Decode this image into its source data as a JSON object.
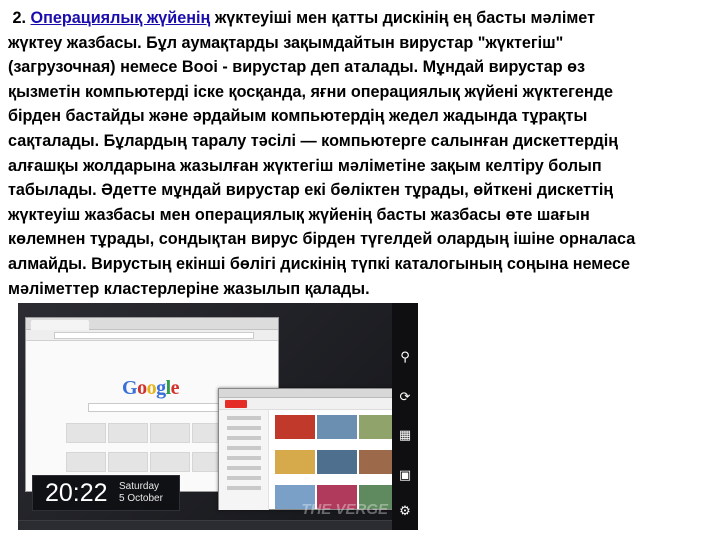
{
  "paragraph": {
    "number": "2.",
    "link_text": "Операциялық жүйенің",
    "line1_rest": "жүктеуіші мен қатты дискінің ең басты мәлімет",
    "line2": "жүктеу жазбасы. Бұл аумақтарды зақымдайтын вирустар \"жүктегіш\"",
    "line3": "(загрузочная) немесе Booi - вирустар деп аталады. Мұндай вирустар өз",
    "line4": "қызметін компьютерді іске қосқанда, яғни операциялық жүйені жүктегенде",
    "line5": "бірден бастайды және әрдайым компьютердің жедел жадында тұрақты",
    "line6": "сақталады. Бұлардың таралу тәсілі — компьютерге салынған дискеттердің",
    "line7": "алғашқы жолдарына жазылған жүктегіш мәліметіне зақым келтіру болып",
    "line8": "табылады. Әдетте мұндай вирустар екі бөліктен тұрады, өйткені дискеттің",
    "line9": "жүктеуіш жазбасы мен операциялық жүйенің басты жазбасы өте шағын",
    "line10": "көлемнен тұрады, сондықтан вирус бірден түгелдей олардың ішіне орналаса",
    "line11": "алмайды. Вирустың екінші бөлігі дискінің түпкі каталогының соңына немесе",
    "line12": "мәліметтер кластерлеріне жазылып қалады."
  },
  "screenshot": {
    "google_logo": [
      "G",
      "o",
      "o",
      "g",
      "l",
      "e"
    ],
    "clock_time": "20:22",
    "clock_day": "Saturday",
    "clock_date": "5 October",
    "charms": [
      {
        "icon": "search-icon",
        "label": "Search"
      },
      {
        "icon": "share-icon",
        "label": "Share"
      },
      {
        "icon": "windows-start-icon",
        "label": "Start"
      },
      {
        "icon": "devices-icon",
        "label": "Devices"
      },
      {
        "icon": "settings-icon",
        "label": "Settings"
      }
    ],
    "watermark": "THE VERGE",
    "youtube_video_colors": [
      "#c0392b",
      "#6b8fb0",
      "#8fa36a",
      "#d6a94a",
      "#4f6f8f",
      "#9c6a4a",
      "#7aa0c8",
      "#b03a5b",
      "#5f8a5f"
    ]
  }
}
